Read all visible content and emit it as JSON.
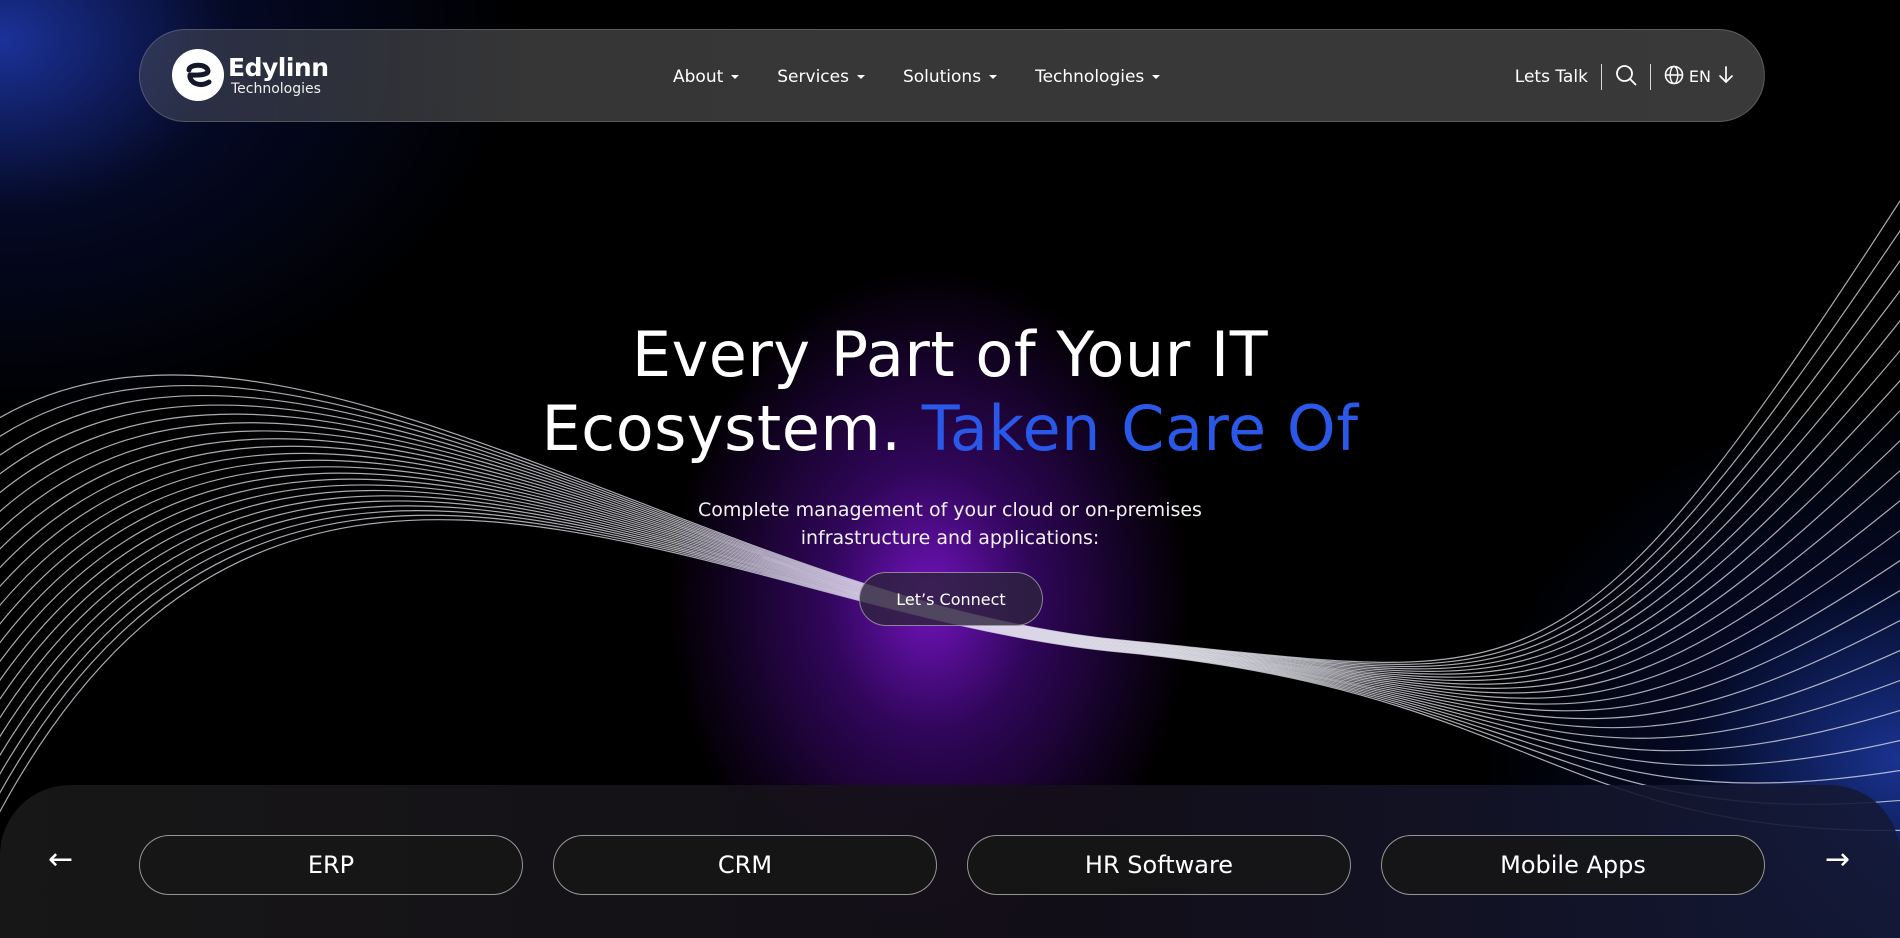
{
  "brand": {
    "name": "Edylinn",
    "subtitle": "Technologies",
    "accent_color": "#2a58e8"
  },
  "nav": {
    "menu": [
      {
        "label": "About"
      },
      {
        "label": "Services"
      },
      {
        "label": "Solutions"
      },
      {
        "label": "Technologies"
      }
    ],
    "talk_label": "Lets Talk",
    "search_icon": "search-icon",
    "language_icon": "globe-icon",
    "language": "EN",
    "language_arrow_icon": "arrow-down-icon"
  },
  "hero": {
    "title_line1": "Every Part of Your IT",
    "title_line2_plain": "Ecosystem.",
    "title_line2_accent": "Taken Care Of",
    "subtitle_line1": "Complete management of your cloud or on-premises",
    "subtitle_line2": "infrastructure and applications:",
    "cta_label": "Let’s Connect"
  },
  "carousel": {
    "prev_icon": "←",
    "next_icon": "→",
    "items": [
      {
        "label": "ERP"
      },
      {
        "label": "CRM"
      },
      {
        "label": "HR Software"
      },
      {
        "label": "Mobile Apps"
      }
    ]
  }
}
